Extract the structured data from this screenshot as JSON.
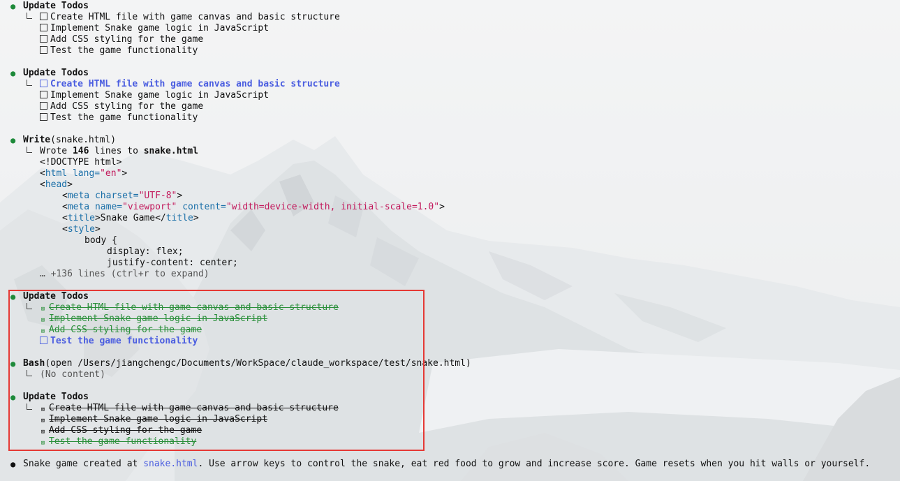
{
  "blocks": {
    "todos1": {
      "title": "Update Todos",
      "items": [
        "Create HTML file with game canvas and basic structure",
        "Implement Snake game logic in JavaScript",
        "Add CSS styling for the game",
        "Test the game functionality"
      ]
    },
    "todos2": {
      "title": "Update Todos",
      "items": [
        "Create HTML file with game canvas and basic structure",
        "Implement Snake game logic in JavaScript",
        "Add CSS styling for the game",
        "Test the game functionality"
      ]
    },
    "write": {
      "tool": "Write",
      "arg": "(snake.html)",
      "result_prefix": "Wrote ",
      "result_count": "146",
      "result_mid": " lines to ",
      "result_file": "snake.html",
      "code": {
        "doctype": "<!DOCTYPE html>",
        "html_open_lt": "<",
        "html_tag": "html",
        "html_attr": " lang=",
        "html_val": "\"en\"",
        "html_gt": ">",
        "head_lt": "<",
        "head_tag": "head",
        "head_gt": ">",
        "meta1_lt": "<",
        "meta1_tag": "meta",
        "meta1_attr": " charset=",
        "meta1_val": "\"UTF-8\"",
        "meta1_gt": ">",
        "meta2_lt": "<",
        "meta2_tag": "meta",
        "meta2_attr1": " name=",
        "meta2_val1": "\"viewport\"",
        "meta2_attr2": " content=",
        "meta2_val2": "\"width=device-width, initial-scale=1.0\"",
        "meta2_gt": ">",
        "title_lt": "<",
        "title_tag": "title",
        "title_gt": ">",
        "title_text": "Snake Game",
        "title_close_lt": "</",
        "title_close_tag": "title",
        "title_close_gt": ">",
        "style_lt": "<",
        "style_tag": "style",
        "style_gt": ">",
        "body_rule": "body {",
        "display": "display: flex;",
        "justify": "justify-content: center;"
      },
      "more": "… +136 lines (ctrl+r to expand)"
    },
    "todos3": {
      "title": "Update Todos",
      "items": [
        "Create HTML file with game canvas and basic structure",
        "Implement Snake game logic in JavaScript",
        "Add CSS styling for the game",
        "Test the game functionality"
      ]
    },
    "bash": {
      "tool": "Bash",
      "arg": "(open /Users/jiangchengc/Documents/WorkSpace/claude_workspace/test/snake.html)",
      "result": "(No content)"
    },
    "todos4": {
      "title": "Update Todos",
      "items": [
        "Create HTML file with game canvas and basic structure",
        "Implement Snake game logic in JavaScript",
        "Add CSS styling for the game",
        "Test the game functionality"
      ]
    },
    "final": {
      "prefix": "Snake game created at ",
      "link": "snake.html",
      "suffix": ". Use arrow keys to control the snake, eat red food to grow and increase score. Game resets when you hit walls or yourself."
    }
  },
  "glyphs": {
    "bullet": "●",
    "checked_box": "⊠"
  },
  "colors": {
    "green": "#1e8a3a",
    "blue": "#4a5de0",
    "highlight": "#e53935"
  }
}
